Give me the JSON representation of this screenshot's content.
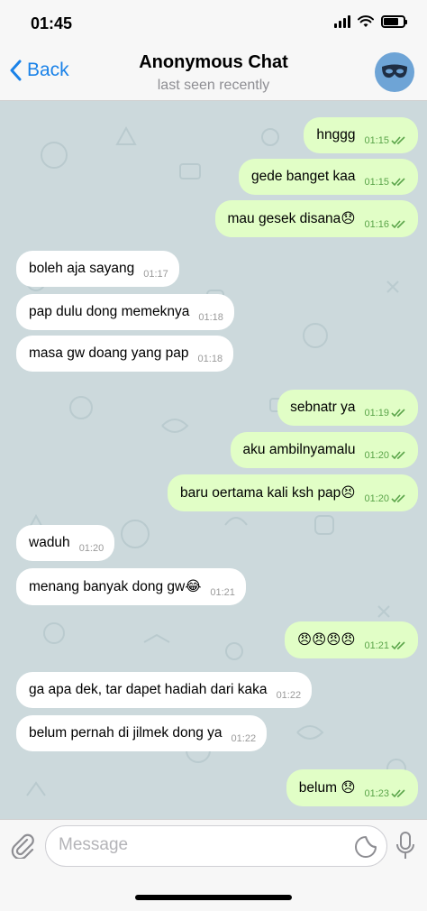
{
  "status_bar": {
    "time": "01:45",
    "battery_level": 0.75
  },
  "nav": {
    "back_label": "Back",
    "title": "Anonymous Chat",
    "subtitle": "last seen recently",
    "avatar_icon": "mask-icon"
  },
  "messages": [
    {
      "dir": "out",
      "text": "hnggg",
      "time": "01:15",
      "read": true
    },
    {
      "dir": "out",
      "text": "gede banget kaa",
      "time": "01:15",
      "read": true
    },
    {
      "dir": "out",
      "text": "mau gesek disana😞",
      "time": "01:16",
      "read": true
    },
    {
      "dir": "in",
      "text": "boleh aja sayang",
      "time": "01:17"
    },
    {
      "dir": "in",
      "text": "pap dulu dong memeknya",
      "time": "01:18"
    },
    {
      "dir": "in",
      "text": "masa gw doang yang pap",
      "time": "01:18"
    },
    {
      "dir": "out",
      "text": "sebnatr ya",
      "time": "01:19",
      "read": true
    },
    {
      "dir": "out",
      "text": "aku ambilnyamalu",
      "time": "01:20",
      "read": true
    },
    {
      "dir": "out",
      "text": "baru oertama kali ksh pap😣",
      "time": "01:20",
      "read": true
    },
    {
      "dir": "in",
      "text": "waduh",
      "time": "01:20"
    },
    {
      "dir": "in",
      "text": "menang banyak dong gw😂",
      "time": "01:21"
    },
    {
      "dir": "out",
      "text": "😠😠😠😠",
      "time": "01:21",
      "read": true
    },
    {
      "dir": "in",
      "text": "ga apa dek, tar dapet hadiah dari kaka",
      "time": "01:22"
    },
    {
      "dir": "in",
      "text": "belum pernah di jilmek dong ya",
      "time": "01:22"
    },
    {
      "dir": "out",
      "text": "belum 😞",
      "time": "01:23",
      "read": true
    }
  ],
  "input": {
    "placeholder": "Message"
  },
  "colors": {
    "accent": "#1a82e8",
    "outgoing": "#e1fec6",
    "incoming": "#ffffff",
    "chat_bg": "#ccd9dc",
    "check": "#5ba54a"
  }
}
